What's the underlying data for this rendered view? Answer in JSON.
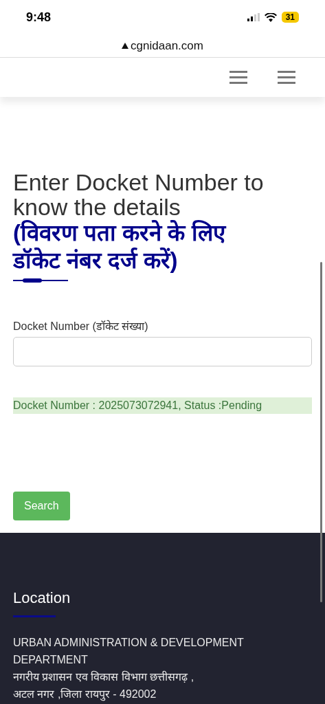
{
  "status_bar": {
    "time": "9:48",
    "battery": "31"
  },
  "address_bar": {
    "url": "cgnidaan.com"
  },
  "page": {
    "title": "Enter Docket Number to know the details",
    "title_hindi": "(विवरण पता करने के लिए डॉकेट नंबर दर्ज करें)",
    "field": {
      "label": "Docket Number (डॉकेट संख्या)"
    },
    "alert": "Docket Number : 2025073072941, Status :Pending",
    "button": "Search"
  },
  "footer": {
    "heading": "Location",
    "lines": [
      "URBAN ADMINISTRATION & DEVELOPMENT DEPARTMENT",
      "नगरीय प्रशासन एव विकास विभाग छत्तीसगढ़ ,",
      "अटल नगर ,जिला रायपुर - 492002"
    ]
  }
}
